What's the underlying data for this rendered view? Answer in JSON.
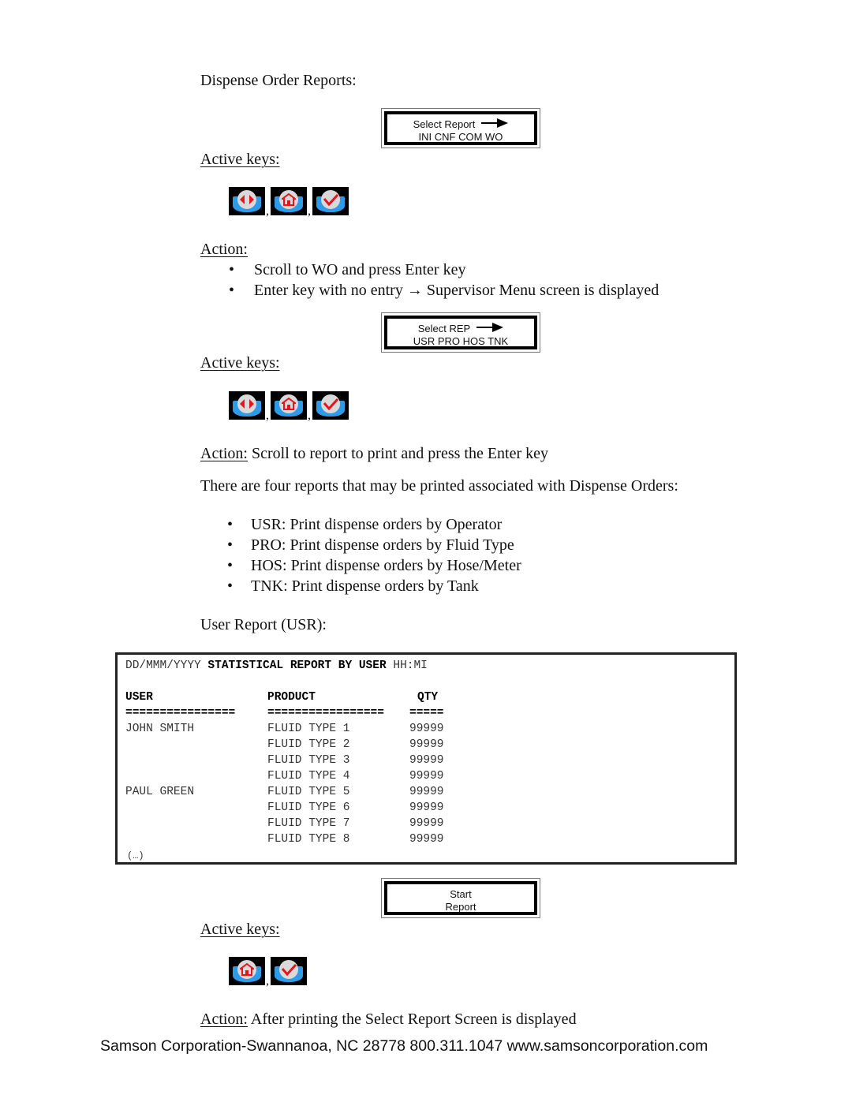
{
  "section1": {
    "heading": "Dispense Order Reports:",
    "lcd": {
      "line1": "Select Report",
      "line2": "INI CNF COM WO",
      "arrow_icon": "right-arrow-icon"
    },
    "active_keys_label": "Active keys:",
    "keys": [
      "scroll-key-icon",
      "home-key-icon",
      "enter-key-icon"
    ],
    "action_label": "Action:",
    "bullets": [
      "Scroll to WO and press Enter key",
      "Enter key with no entry → Supervisor Menu screen is displayed"
    ]
  },
  "section2": {
    "lcd": {
      "line1": "Select REP",
      "line2": "USR PRO HOS TNK",
      "arrow_icon": "right-arrow-icon"
    },
    "active_keys_label": "Active keys:",
    "keys": [
      "scroll-key-icon",
      "home-key-icon",
      "enter-key-icon"
    ],
    "action_label": "Action:",
    "action_text": " Scroll to report to print and press the Enter key",
    "intro": "There are four reports that may be printed associated with Dispense Orders:",
    "reports": [
      "USR:  Print dispense orders by Operator",
      "PRO:  Print dispense orders by Fluid Type",
      "HOS:  Print dispense orders by Hose/Meter",
      "TNK:  Print dispense orders by Tank"
    ],
    "user_report_heading": "User Report (USR):"
  },
  "report": {
    "date": "DD/MMM/YYYY",
    "title": "STATISTICAL REPORT BY USER",
    "time": "HH:MI",
    "columns": [
      "USER",
      "PRODUCT",
      "QTY"
    ],
    "underline": [
      "================",
      "=================",
      "====="
    ],
    "rows": [
      {
        "user": "JOHN SMITH",
        "product": "FLUID TYPE 1",
        "qty": "99999"
      },
      {
        "user": "",
        "product": "FLUID TYPE 2",
        "qty": "99999"
      },
      {
        "user": "",
        "product": "FLUID TYPE 3",
        "qty": "99999"
      },
      {
        "user": "",
        "product": "FLUID TYPE 4",
        "qty": "99999"
      },
      {
        "user": "PAUL GREEN",
        "product": "FLUID TYPE 5",
        "qty": "99999"
      },
      {
        "user": "",
        "product": "FLUID TYPE 6",
        "qty": "99999"
      },
      {
        "user": "",
        "product": "FLUID TYPE 7",
        "qty": "99999"
      },
      {
        "user": "",
        "product": "FLUID TYPE 8",
        "qty": "99999"
      }
    ],
    "ellipsis": "(…)"
  },
  "section3": {
    "lcd": {
      "line1": "Start",
      "line2": "Report"
    },
    "active_keys_label": "Active keys:",
    "keys": [
      "home-key-icon",
      "enter-key-icon"
    ],
    "action_label": "Action:",
    "action_text": " After printing the Select Report Screen is displayed"
  },
  "footer": {
    "text": "Samson Corporation-Swannanoa, NC 28778  800.311.1047 www.samsoncorporation.com"
  },
  "colors": {
    "key_blue": "#2d9be8",
    "key_red": "#e8141c",
    "key_disc": "#d9d9d9"
  }
}
